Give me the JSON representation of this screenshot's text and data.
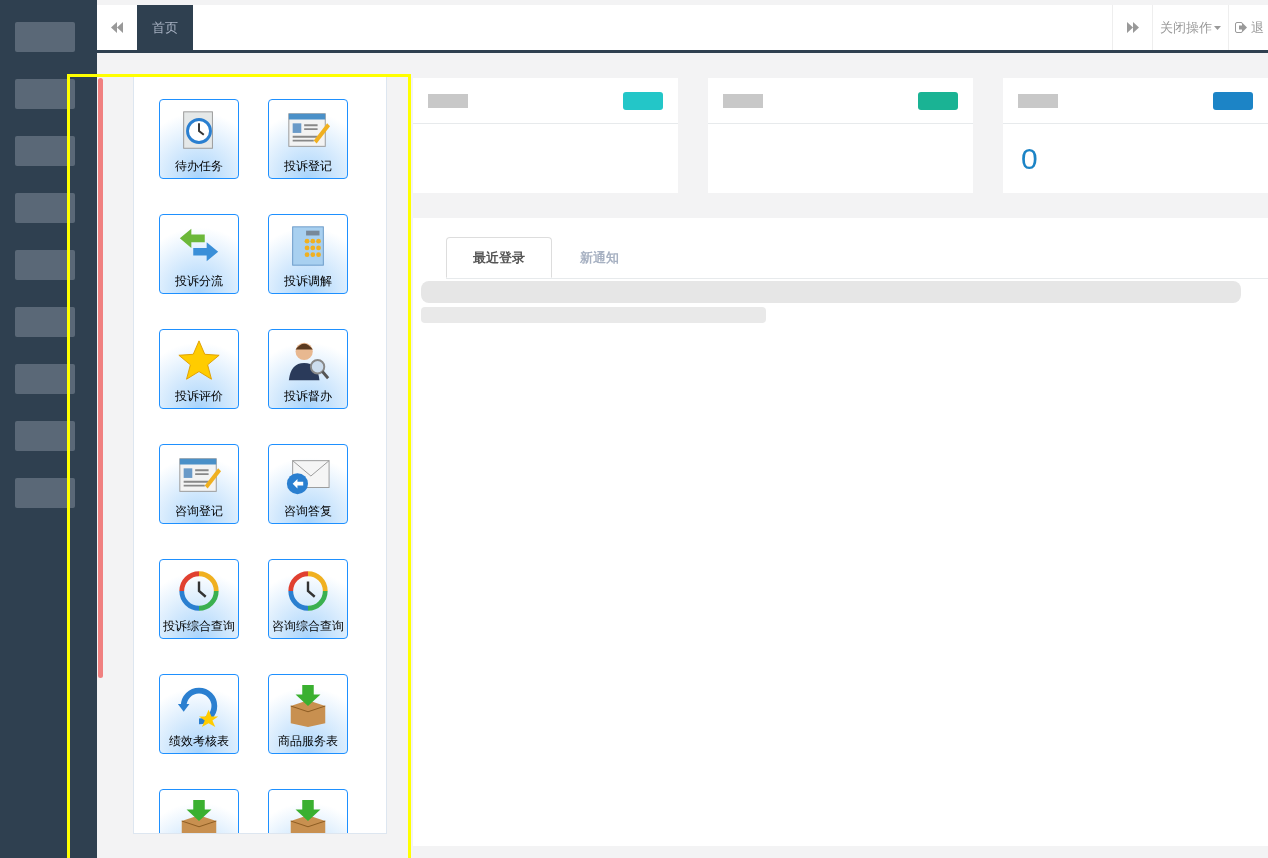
{
  "topbar": {
    "tabs": [
      {
        "label": "首页",
        "selected": true
      }
    ],
    "close_menu": {
      "label": "关闭操作"
    },
    "logout": {
      "label": "退"
    }
  },
  "stat_cards": [
    {
      "color": "#23c6c8"
    },
    {
      "color": "#1ab394"
    },
    {
      "color": "#1c84c6",
      "value": "0"
    }
  ],
  "shortcuts": [
    {
      "label": "待办任务",
      "kind": "clock"
    },
    {
      "label": "投诉登记",
      "kind": "form"
    },
    {
      "label": "投诉分流",
      "kind": "arrows"
    },
    {
      "label": "投诉调解",
      "kind": "phone"
    },
    {
      "label": "投诉评价",
      "kind": "star"
    },
    {
      "label": "投诉督办",
      "kind": "person"
    },
    {
      "label": "咨询登记",
      "kind": "form"
    },
    {
      "label": "咨询答复",
      "kind": "mail"
    },
    {
      "label": "投诉综合查询",
      "kind": "gauge"
    },
    {
      "label": "咨询综合查询",
      "kind": "gauge"
    },
    {
      "label": "绩效考核表",
      "kind": "refresh"
    },
    {
      "label": "商品服务表",
      "kind": "box"
    },
    {
      "kind": "box"
    },
    {
      "kind": "box"
    }
  ],
  "tabs": [
    {
      "label": "最近登录",
      "selected": true
    },
    {
      "label": "新通知",
      "selected": false
    }
  ]
}
